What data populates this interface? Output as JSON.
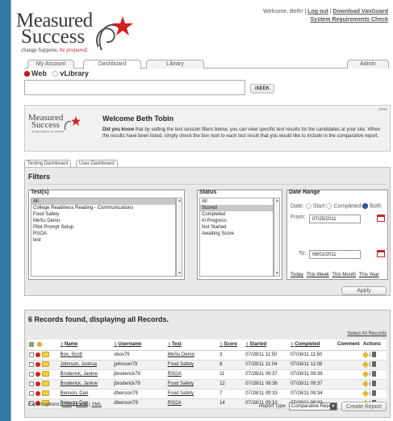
{
  "brand": {
    "logo_line1": "Measured",
    "logo_line2": "Success",
    "tagline_plain": "change happens.",
    "tagline_red": "be prepared.",
    "accent_color": "#c21f1f"
  },
  "header": {
    "welcome": "Welcome, Beth! |",
    "logout": "Log out",
    "download": "Download VanGuard",
    "sysreq": "System Requirements Check"
  },
  "nav": {
    "tabs": [
      "My Account",
      "Dashboard",
      "Library"
    ],
    "admin": "Admin",
    "active_tab": "Dashboard"
  },
  "search": {
    "scope_web": "Web",
    "scope_vlibrary": "vLibrary",
    "selected_scope": "Web",
    "value": "",
    "seek_label": "iSEEK"
  },
  "welcome_box": {
    "close": "close",
    "logo_a": "Measured",
    "logo_b": "Success",
    "logo_c": "change happens. be prepared.",
    "title": "Welcome Beth Tobin",
    "lead": "Did you know",
    "body": " that by setting the test session filters below, you can view specific test results for the candidates at your site. When the results have been listed, simply check the box next to each test result that you would like to include in the comparative report."
  },
  "dashboard_tabs": [
    "Testing Dashboard",
    "User Dashboard"
  ],
  "filters": {
    "title": "Filters",
    "tests_label": "Test(s)",
    "tests": [
      "All",
      "College Readiness Reading - Communications",
      "Food Safety",
      "MeSu Demo",
      "Pilot Prompt Setup",
      "RSOA",
      "test"
    ],
    "tests_selected": "All",
    "status_label": "Status",
    "statuses": [
      "All",
      "Scored",
      "Completed",
      "In Progress",
      "Not Started",
      "Awaiting Score"
    ],
    "status_selected": "Scored",
    "date_range_label": "Date Range",
    "date_label": "Date:",
    "date_options": [
      "Start",
      "Completed",
      "Both"
    ],
    "date_option_selected": "Both",
    "from_label": "From:",
    "from_value": "07/25/2011",
    "to_label": "To:",
    "to_value": "08/01/2011",
    "quick_links": [
      "Today",
      "This Week",
      "This Month",
      "This Year"
    ],
    "apply_label": "Apply"
  },
  "records": {
    "summary": "6 Records found, displaying all Records.",
    "select_all": "Select All Records",
    "columns": [
      "Name",
      "Username",
      "Test",
      "Score",
      "Started",
      "Completed",
      "Comment",
      "Actions"
    ],
    "rows": [
      {
        "name": "Box, Scott",
        "username": "sbox79",
        "test": "MeSu Demo",
        "score": "3",
        "started": "07/28/11 11:50",
        "completed": "07/28/11 11:50"
      },
      {
        "name": "Johnson, Joshua",
        "username": "jjohnson79",
        "test": "Food Safety",
        "score": "8",
        "started": "07/28/11 11:04",
        "completed": "07/28/11 11:08"
      },
      {
        "name": "Broderick, Janine",
        "username": "jbroderick79",
        "test": "RSOA",
        "score": "11",
        "started": "07/28/11 09:37",
        "completed": "07/28/11 09:38"
      },
      {
        "name": "Broderick, Janine",
        "username": "jbroderick79",
        "test": "Food Safety",
        "score": "12",
        "started": "07/28/11 09:36",
        "completed": "07/28/11 09:37"
      },
      {
        "name": "Benson, Dan",
        "username": "dbenson79",
        "test": "Food Safety",
        "score": "7",
        "started": "07/28/11 09:33",
        "completed": "07/28/11 09:34"
      },
      {
        "name": "Benson, Dan",
        "username": "dbenson79",
        "test": "RSOA",
        "score": "14",
        "started": "07/28/11 09:32",
        "completed": "07/28/11 09:33"
      }
    ],
    "export_label": "Export options:",
    "export_options": [
      "CSV",
      "Excel",
      "XML"
    ],
    "report_type_label": "Report Type:",
    "report_type_value": "Comparative Report",
    "create_label": "Create Report"
  }
}
